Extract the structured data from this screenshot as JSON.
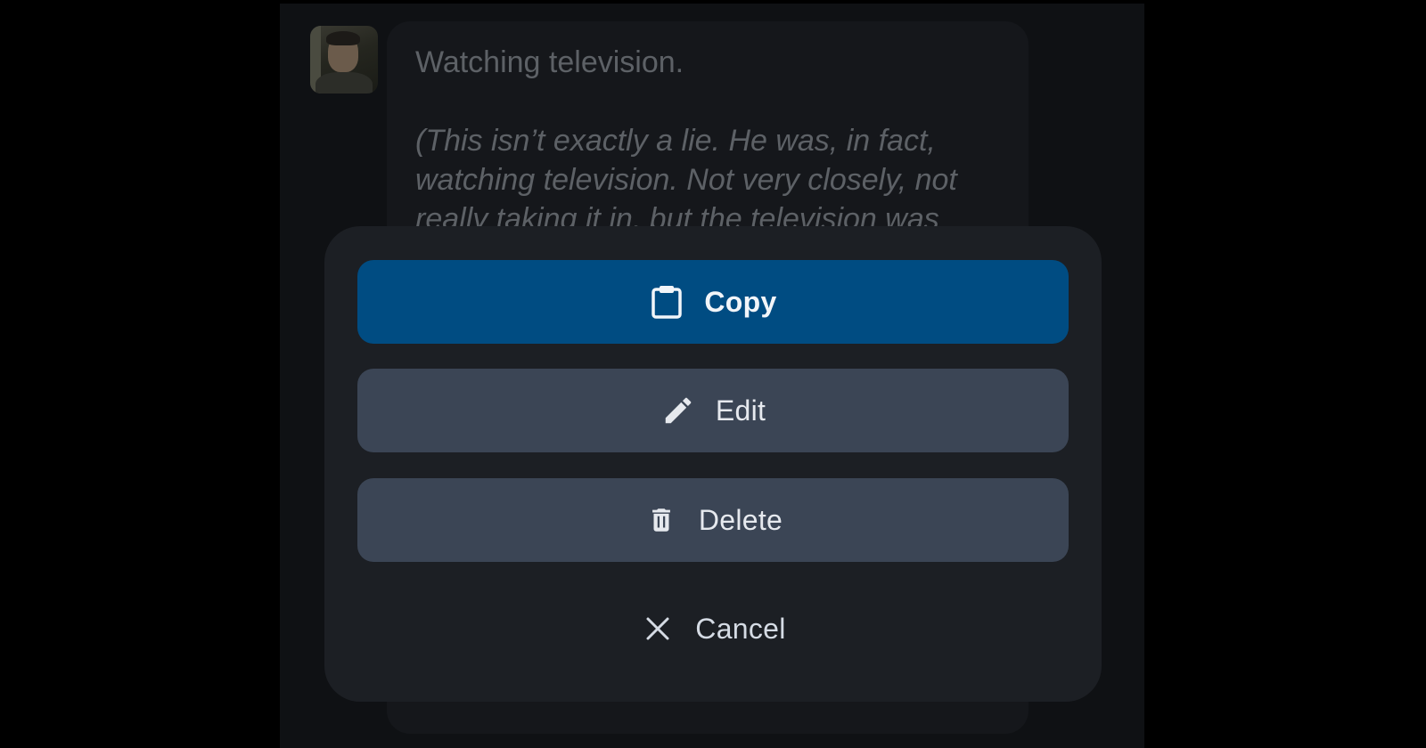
{
  "message": {
    "line1": "Watching television.",
    "italic_lines": [
      "(This isn’t exactly a lie. He was, in fact,",
      "watching television. Not very closely, not",
      "really taking it in, but the television was"
    ]
  },
  "actions": {
    "copy": {
      "label": "Copy",
      "icon": "clipboard-icon"
    },
    "edit": {
      "label": "Edit",
      "icon": "pencil-icon"
    },
    "delete": {
      "label": "Delete",
      "icon": "trash-icon"
    },
    "cancel": {
      "label": "Cancel",
      "icon": "close-icon"
    }
  },
  "colors": {
    "primary": "#004c82",
    "secondary_button": "#3b4555",
    "sheet": "#1c1f24",
    "background": "#000000"
  }
}
